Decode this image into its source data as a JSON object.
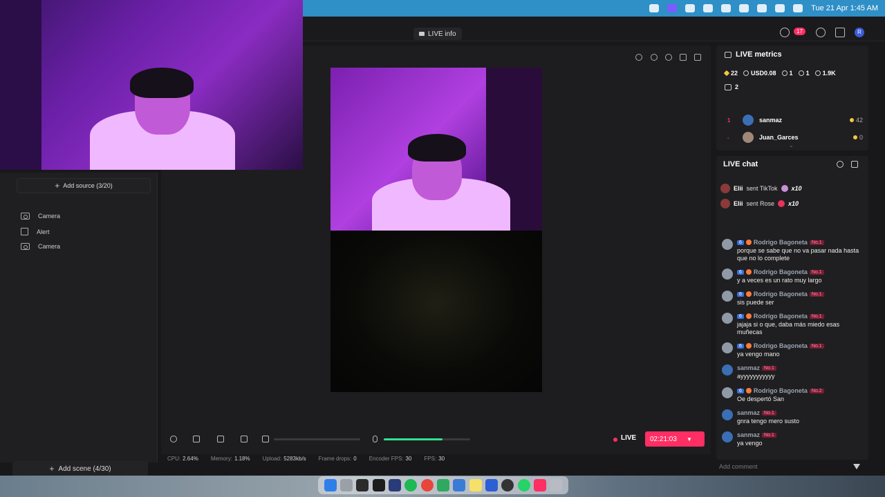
{
  "menubar": {
    "clock": "Tue 21 Apr  1:45 AM"
  },
  "header": {
    "live_info_label": "LIVE info",
    "notification_count": "17",
    "avatar_initial": "R"
  },
  "sources": {
    "add_source_label": "Add source (3/20)",
    "items": [
      {
        "label": "Camera",
        "icon": "camera-icon"
      },
      {
        "label": "Alert",
        "icon": "alert-icon"
      },
      {
        "label": "Camera",
        "icon": "camera-icon"
      }
    ]
  },
  "scenes": {
    "add_scene_label": "Add scene (4/30)"
  },
  "controls": {
    "mic_level": 0.68,
    "live_label": "LIVE",
    "timer": "02:21:03"
  },
  "stats": [
    {
      "label": "CPU:",
      "value": "2.64%"
    },
    {
      "label": "Memory:",
      "value": "1.18%"
    },
    {
      "label": "Upload:",
      "value": "5283kb/s"
    },
    {
      "label": "Frame drops:",
      "value": "0"
    },
    {
      "label": "Encoder FPS:",
      "value": "30"
    },
    {
      "label": "FPS:",
      "value": "30"
    }
  ],
  "metrics": {
    "title": "LIVE metrics",
    "diamonds": "22",
    "earnings": "USD0.08",
    "viewers": "1",
    "new_followers": "1",
    "likes": "1.9K",
    "gifts": "2",
    "top_viewers": [
      {
        "rank": "1",
        "name": "sanmaz",
        "coins": "42"
      },
      {
        "rank": "-",
        "name": "Juan_Garces",
        "coins": "0"
      }
    ]
  },
  "chat": {
    "title": "LIVE chat",
    "gifts": [
      {
        "name": "Elii",
        "action": "sent TikTok",
        "multiplier": "x10"
      },
      {
        "name": "Elii",
        "action": "sent Rose",
        "multiplier": "x10"
      }
    ],
    "messages": [
      {
        "level": "6",
        "user": "Rodrigo Bagoneta",
        "badge": "No.1",
        "text": "porque se sabe que no va pasar nada hasta que no lo complete"
      },
      {
        "level": "6",
        "user": "Rodrigo Bagoneta",
        "badge": "No.1",
        "text": "y a veces es un rato muy largo"
      },
      {
        "level": "6",
        "user": "Rodrigo Bagoneta",
        "badge": "No.1",
        "text": "sis puede ser"
      },
      {
        "level": "6",
        "user": "Rodrigo Bagoneta",
        "badge": "No.1",
        "text": "jajaja si o que, daba más miedo esas muñecas"
      },
      {
        "level": "6",
        "user": "Rodrigo Bagoneta",
        "badge": "No.1",
        "text": "ya vengo mano"
      },
      {
        "level": "",
        "user": "sanmaz",
        "badge": "No.1",
        "text": "ayyyyyyyyyyy"
      },
      {
        "level": "6",
        "user": "Rodrigo Bagoneta",
        "badge": "No.2",
        "text": "Oe despertó San"
      },
      {
        "level": "",
        "user": "sanmaz",
        "badge": "No.1",
        "text": "gnra tengo mero susto"
      },
      {
        "level": "",
        "user": "sanmaz",
        "badge": "No.1",
        "text": "ya vengo"
      }
    ],
    "comment_placeholder": "Add comment"
  },
  "colors": {
    "accent": "#ff2e63",
    "mic_level": "#2fe38d"
  }
}
